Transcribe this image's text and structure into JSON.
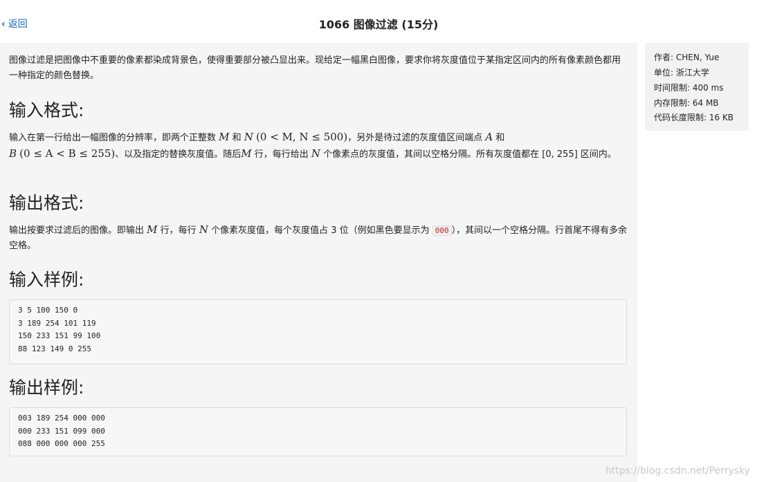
{
  "header": {
    "back_label": "返回",
    "title": "1066 图像过滤 (15分)"
  },
  "problem": {
    "description": "图像过滤是把图像中不重要的像素都染成背景色，使得重要部分被凸显出来。现给定一幅黑白图像，要求你将灰度值位于某指定区间内的所有像素颜色都用一种指定的颜色替换。",
    "input_heading": "输入格式:",
    "input_text_1": "输入在第一行给出一幅图像的分辨率，即两个正整数",
    "input_M": "M",
    "input_and": "和",
    "input_N": "N",
    "input_range": "(0 < M, N ≤ 500)",
    "input_text_2": "，另外是待过滤的灰度值区间端点",
    "input_A": "A",
    "input_and2": "和",
    "input_B": "B",
    "input_range2": "(0 ≤ A < B ≤ 255)",
    "input_text_3": "、以及指定的替换灰度值。随后",
    "input_M2": "M",
    "input_text_4": "行，每行给出",
    "input_N2": "N",
    "input_text_5": "个像素点的灰度值，其间以空格分隔。所有灰度值都在 [0, 255] 区间内。",
    "output_heading": "输出格式:",
    "output_text_1": "输出按要求过滤后的图像。即输出",
    "output_M": "M",
    "output_text_2": "行，每行",
    "output_N": "N",
    "output_text_3": "个像素灰度值，每个灰度值占 3 位（例如黑色要显示为",
    "output_code": "000",
    "output_text_4": "），其间以一个空格分隔。行首尾不得有多余空格。",
    "sample_in_heading": "输入样例:",
    "sample_in_lines": [
      "3 5 100 150 0",
      "3 189 254 101 119",
      "150 233 151 99 100",
      "88 123 149 0 255"
    ],
    "sample_out_heading": "输出样例:",
    "sample_out_lines": [
      "003 189 254 000 000",
      "000 233 151 099 000",
      "088 000 000 000 255"
    ]
  },
  "sidebar": {
    "author": "作者: CHEN, Yue",
    "unit": "单位: 浙江大学",
    "time_limit": "时间限制: 400 ms",
    "memory_limit": "内存限制: 64 MB",
    "code_limit": "代码长度限制: 16 KB"
  },
  "watermark": "https://blog.csdn.net/Perrysky",
  "colors": {
    "link": "#1565c0",
    "panel": "#f5f5f5",
    "inline_code": "#c62828"
  }
}
